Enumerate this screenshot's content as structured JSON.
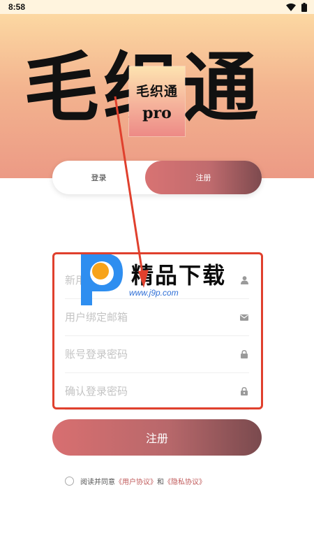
{
  "status_bar": {
    "time": "8:58"
  },
  "hero": {
    "title": "毛织通",
    "logo_line1": "毛织通",
    "logo_line2": "pro"
  },
  "tabs": {
    "login": "登录",
    "register": "注册",
    "active": "register"
  },
  "form": {
    "fields": [
      {
        "placeholder": "新用户名",
        "value": "",
        "icon": "user-icon"
      },
      {
        "placeholder": "用户绑定邮箱",
        "value": "",
        "icon": "mail-icon"
      },
      {
        "placeholder": "账号登录密码",
        "value": "",
        "icon": "lock-icon"
      },
      {
        "placeholder": "确认登录密码",
        "value": "",
        "icon": "lock-icon"
      }
    ],
    "submit_label": "注册"
  },
  "agreement": {
    "checked": false,
    "prefix": "阅读并同意",
    "user_agreement": "《用户协议》",
    "conjunction": "和",
    "privacy_agreement": "《隐私协议》"
  },
  "watermark": {
    "text": "精品下载",
    "url": "www.j9p.com"
  },
  "colors": {
    "accent_start": "#d86f70",
    "accent_end": "#7a4a4e",
    "annotation": "#e0402d",
    "link": "#c05a5a"
  }
}
